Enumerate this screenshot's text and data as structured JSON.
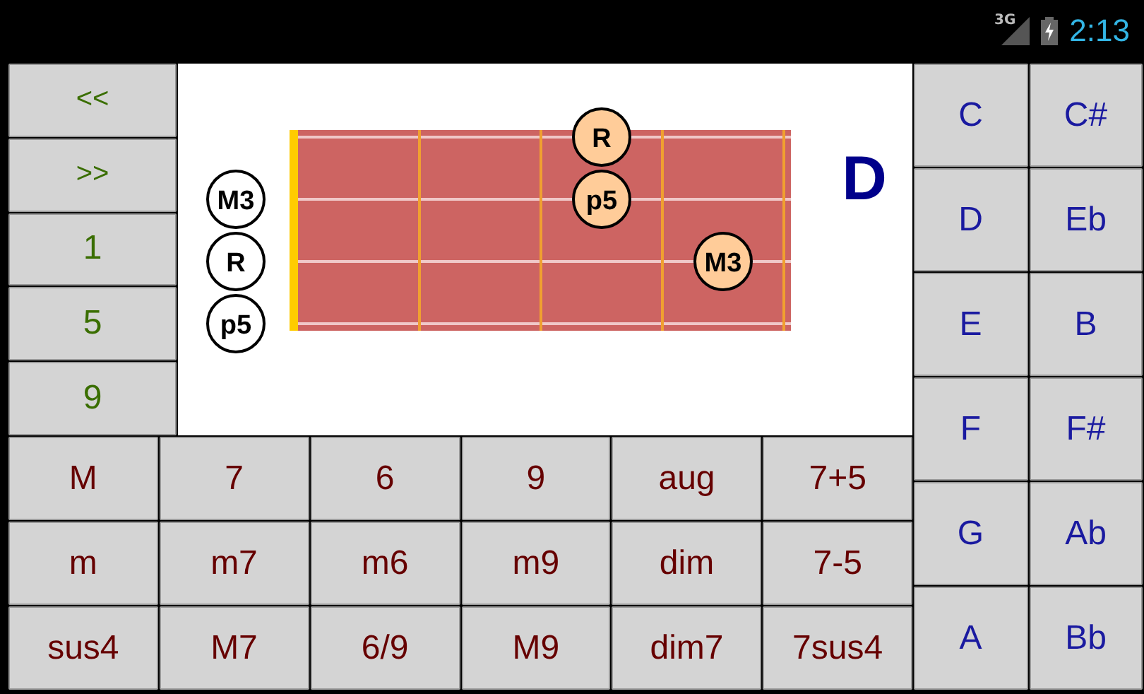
{
  "status_bar": {
    "network": "3G",
    "time": "2:13"
  },
  "nav_buttons": [
    "<<",
    ">>",
    "1",
    "5",
    "9"
  ],
  "diagram": {
    "chord_name": "D",
    "strings": [
      {
        "frets": [
          {
            "kind": "empty"
          },
          {
            "kind": "empty"
          },
          {
            "kind": "note",
            "note": "R"
          },
          {
            "kind": "empty"
          }
        ]
      },
      {
        "open": "M3",
        "frets": [
          {
            "kind": "empty"
          },
          {
            "kind": "empty"
          },
          {
            "kind": "note",
            "note": "p5"
          },
          {
            "kind": "empty"
          }
        ]
      },
      {
        "open": "R",
        "frets": [
          {
            "kind": "empty"
          },
          {
            "kind": "empty"
          },
          {
            "kind": "empty"
          },
          {
            "kind": "note",
            "note": "M3"
          }
        ]
      },
      {
        "open": "p5",
        "frets": [
          {
            "kind": "empty"
          },
          {
            "kind": "empty"
          },
          {
            "kind": "empty"
          },
          {
            "kind": "empty"
          }
        ]
      }
    ]
  },
  "chord_types": [
    [
      "M",
      "7",
      "6",
      "9",
      "aug",
      "7+5"
    ],
    [
      "m",
      "m7",
      "m6",
      "m9",
      "dim",
      "7-5"
    ],
    [
      "sus4",
      "M7",
      "6/9",
      "M9",
      "dim7",
      "7sus4"
    ]
  ],
  "keys": [
    [
      "C",
      "C#"
    ],
    [
      "D",
      "Eb"
    ],
    [
      "E",
      "B"
    ],
    [
      "F",
      "F#"
    ],
    [
      "G",
      "Ab"
    ],
    [
      "A",
      "Bb"
    ]
  ]
}
